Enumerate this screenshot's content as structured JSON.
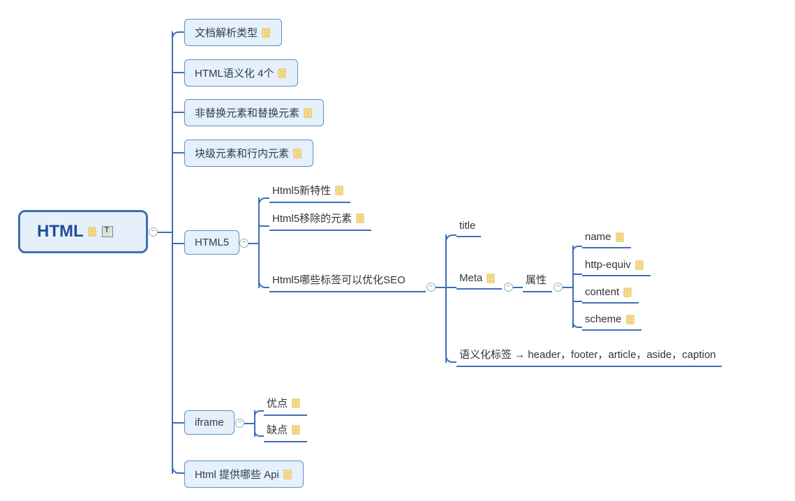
{
  "root": {
    "label": "HTML"
  },
  "level1": {
    "docParse": "文档解析类型",
    "semantic4": "HTML语义化 4个",
    "replaced": "非替换元素和替换元素",
    "blockInline": "块级元素和行内元素",
    "html5": "HTML5",
    "iframe": "iframe",
    "htmlApi": "Html 提供哪些 Api"
  },
  "html5Children": {
    "newFeature": "Html5新特性",
    "removed": "Html5移除的元素",
    "seo": "Html5哪些标签可以优化SEO"
  },
  "seoChildren": {
    "title": "title",
    "meta": "Meta",
    "semanticTags": "语义化标签 → header，footer，article，aside，caption"
  },
  "metaChildren": {
    "attr": "属性"
  },
  "attrChildren": {
    "name": "name",
    "httpEquiv": "http-equiv",
    "content": "content",
    "scheme": "scheme"
  },
  "iframeChildren": {
    "pros": "优点",
    "cons": "缺点"
  }
}
